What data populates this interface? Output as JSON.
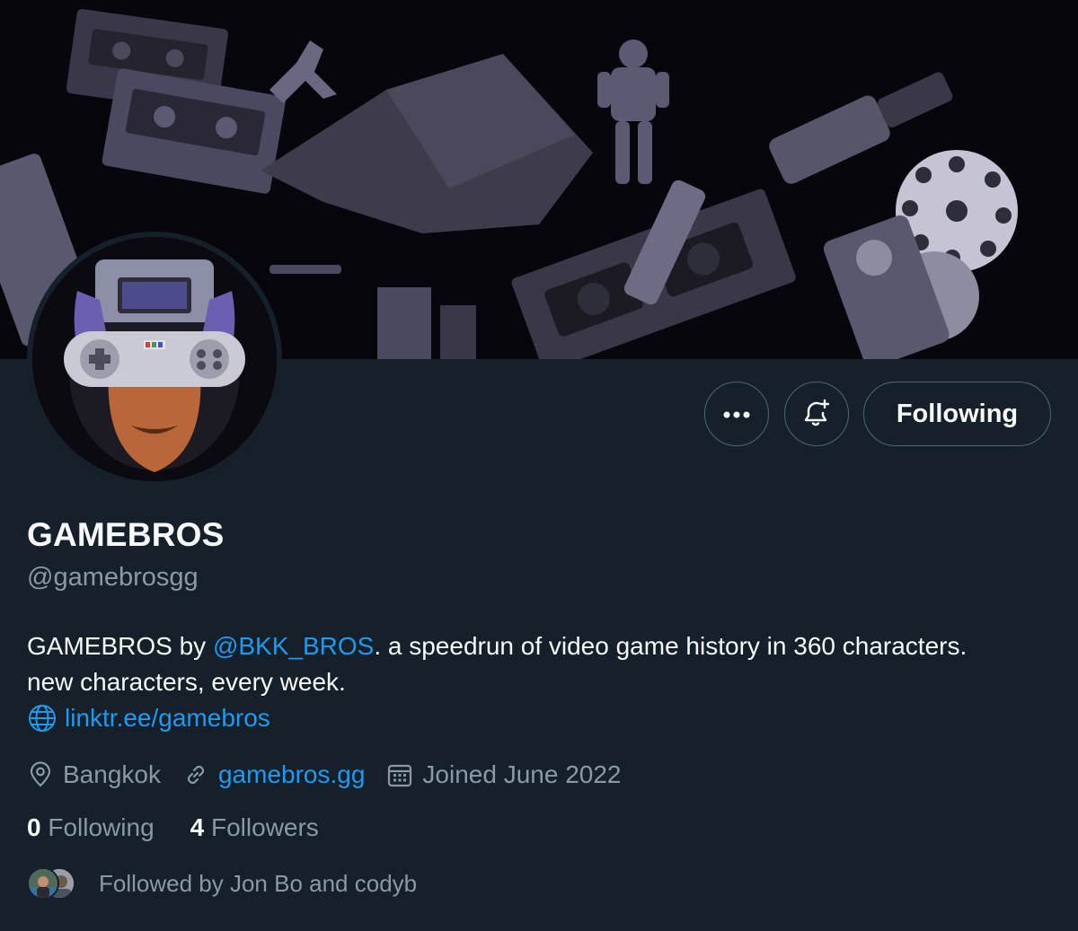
{
  "profile": {
    "display_name": "GAMEBROS",
    "handle": "@gamebrosgg",
    "bio_prefix": "GAMEBROS by ",
    "bio_mention": "@BKK_BROS",
    "bio_line1_rest": ". a speedrun of video game history in 360 characters.",
    "bio_line2": "new characters, every week.",
    "bio_link": "linktr.ee/gamebros"
  },
  "meta": {
    "location": "Bangkok",
    "website": "gamebros.gg",
    "joined": "Joined June 2022"
  },
  "stats": {
    "following_count": "0",
    "following_label": "Following",
    "followers_count": "4",
    "followers_label": "Followers"
  },
  "actions": {
    "more_label": "•••",
    "following_button": "Following"
  },
  "followed_by": "Followed by Jon Bo and codyb",
  "icons": {
    "more": "more-icon",
    "notify": "bell-plus-icon",
    "globe": "globe-icon",
    "location": "location-pin-icon",
    "website": "link-icon",
    "joined": "calendar-icon"
  },
  "colors": {
    "background": "#15202b",
    "link": "#1d9bf0",
    "secondary_text": "#8b98a5",
    "primary_text": "#f7f9f9",
    "border": "#536471"
  }
}
